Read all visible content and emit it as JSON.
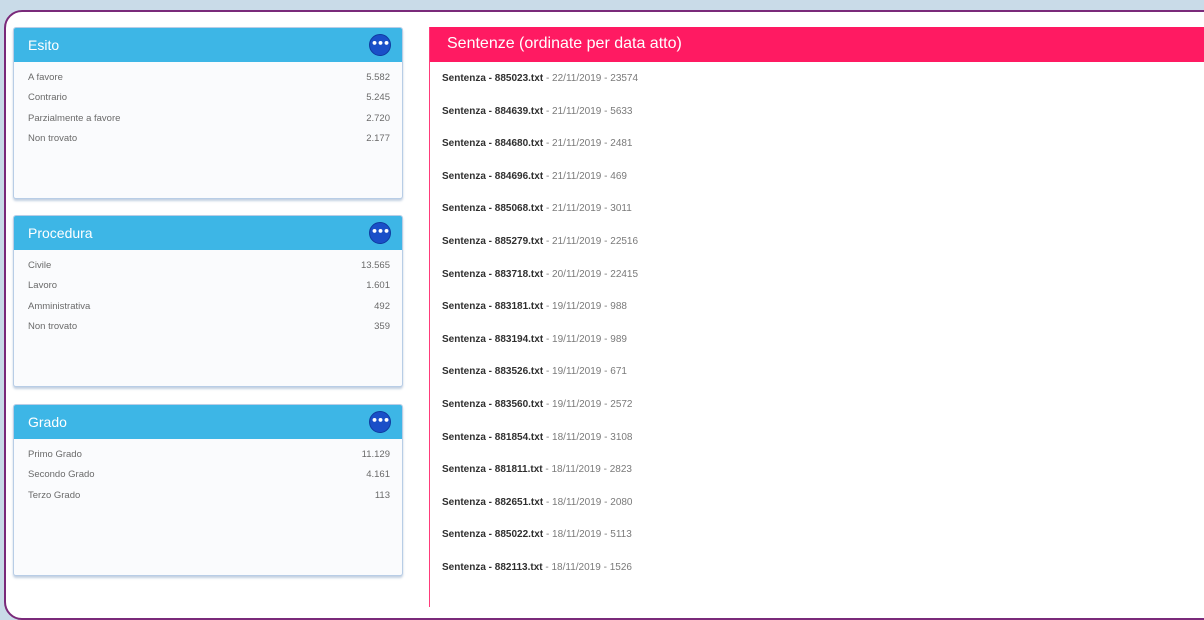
{
  "panels": [
    {
      "title": "Esito",
      "rows": [
        {
          "label": "A favore",
          "value": "5.582"
        },
        {
          "label": "Contrario",
          "value": "5.245"
        },
        {
          "label": "Parzialmente a favore",
          "value": "2.720"
        },
        {
          "label": "Non trovato",
          "value": "2.177"
        }
      ]
    },
    {
      "title": "Procedura",
      "rows": [
        {
          "label": "Civile",
          "value": "13.565"
        },
        {
          "label": "Lavoro",
          "value": "1.601"
        },
        {
          "label": "Amministrativa",
          "value": "492"
        },
        {
          "label": "Non trovato",
          "value": "359"
        }
      ]
    },
    {
      "title": "Grado",
      "rows": [
        {
          "label": "Primo Grado",
          "value": "11.129"
        },
        {
          "label": "Secondo Grado",
          "value": "4.161"
        },
        {
          "label": "Terzo Grado",
          "value": "113"
        }
      ]
    }
  ],
  "more_icon": "more-horizontal-icon",
  "main": {
    "title": "Sentenze (ordinate per data atto)",
    "items": [
      {
        "name": "Sentenza - 885023.txt",
        "detail": " - 22/11/2019 - 23574"
      },
      {
        "name": "Sentenza - 884639.txt",
        "detail": " - 21/11/2019 - 5633"
      },
      {
        "name": "Sentenza - 884680.txt",
        "detail": " - 21/11/2019 - 2481"
      },
      {
        "name": "Sentenza - 884696.txt",
        "detail": " - 21/11/2019 - 469"
      },
      {
        "name": "Sentenza - 885068.txt",
        "detail": " - 21/11/2019 - 3011"
      },
      {
        "name": "Sentenza - 885279.txt",
        "detail": " - 21/11/2019 - 22516"
      },
      {
        "name": "Sentenza - 883718.txt",
        "detail": " - 20/11/2019 - 22415"
      },
      {
        "name": "Sentenza - 883181.txt",
        "detail": " - 19/11/2019 - 988"
      },
      {
        "name": "Sentenza - 883194.txt",
        "detail": " - 19/11/2019 - 989"
      },
      {
        "name": "Sentenza - 883526.txt",
        "detail": " - 19/11/2019 - 671"
      },
      {
        "name": "Sentenza - 883560.txt",
        "detail": " - 19/11/2019 - 2572"
      },
      {
        "name": "Sentenza - 881854.txt",
        "detail": " - 18/11/2019 - 3108"
      },
      {
        "name": "Sentenza - 881811.txt",
        "detail": " - 18/11/2019 - 2823"
      },
      {
        "name": "Sentenza - 882651.txt",
        "detail": " - 18/11/2019 - 2080"
      },
      {
        "name": "Sentenza - 885022.txt",
        "detail": " - 18/11/2019 - 5113"
      },
      {
        "name": "Sentenza - 882113.txt",
        "detail": " - 18/11/2019 - 1526"
      }
    ]
  },
  "colors": {
    "panel_header": "#3db6e6",
    "main_header": "#ff1a62",
    "button": "#1a4fc8",
    "frame_border": "#7a2a7a"
  }
}
